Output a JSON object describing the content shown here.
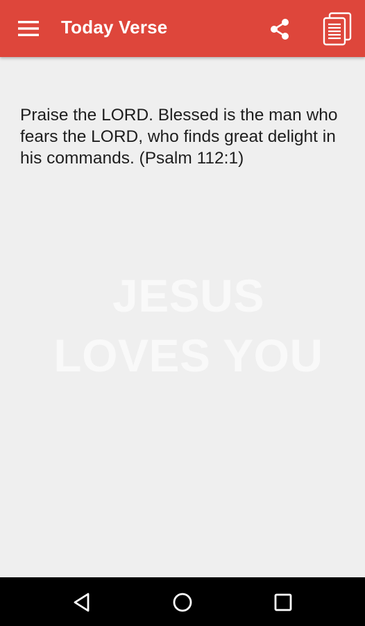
{
  "app_bar": {
    "title": "Today Verse",
    "background_color": "#de463b",
    "icons": {
      "menu": "menu-icon",
      "share": "share-icon",
      "copy": "copy-icon"
    }
  },
  "content": {
    "verse": "Praise the LORD. Blessed is the man who fears the LORD, who finds great delight in his commands. (Psalm 112:1)",
    "watermark_line1": "JESUS",
    "watermark_line2": "LOVES YOU",
    "background_color": "#efefef"
  },
  "nav_bar": {
    "icons": {
      "back": "back-triangle-icon",
      "home": "home-circle-icon",
      "recent": "recent-apps-square-icon"
    }
  }
}
